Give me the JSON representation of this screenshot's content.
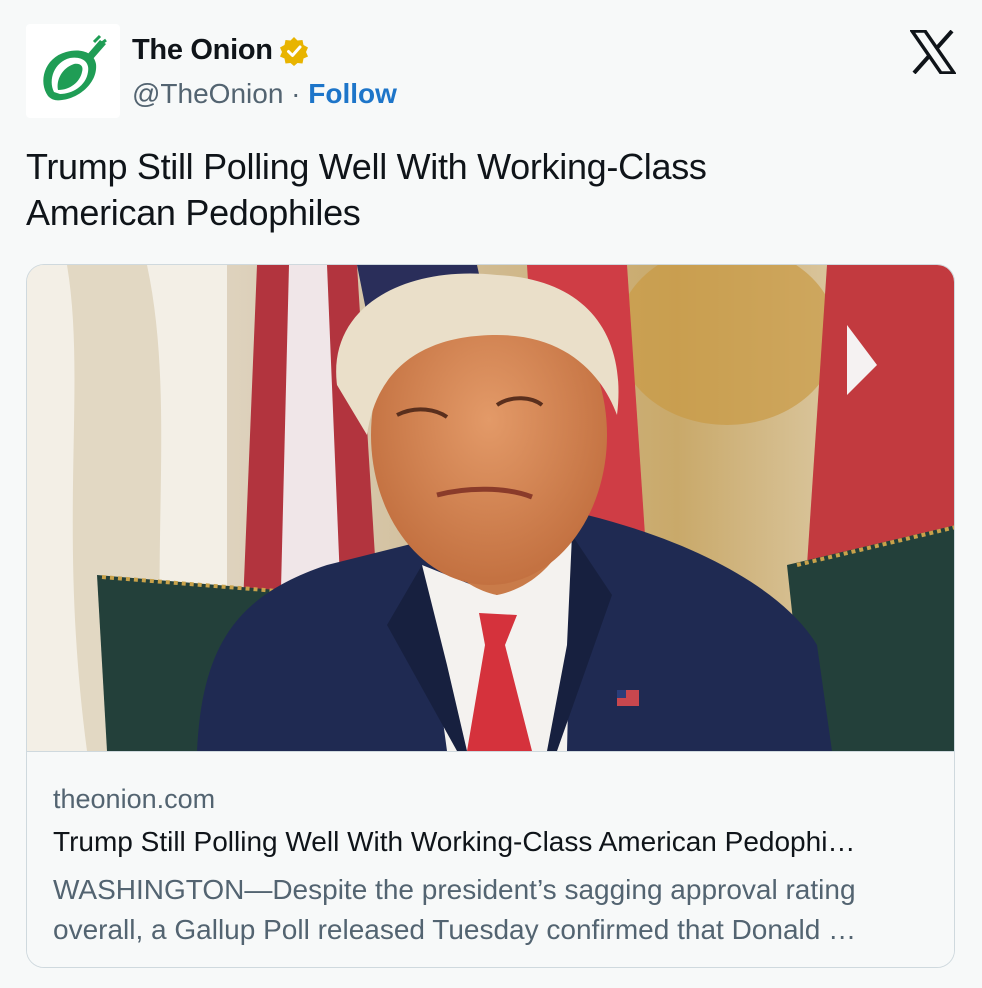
{
  "account": {
    "avatar_icon": "onion-logo-icon",
    "name": "The Onion",
    "handle": "@TheOnion",
    "separator": "·",
    "follow_label": "Follow",
    "verified_icon": "verified-badge-icon",
    "brand_icon": "x-logo-icon"
  },
  "tweet": {
    "text_line1": "Trump Still Polling Well With Working-Class",
    "text_line2": "American Pedophiles"
  },
  "link_card": {
    "image_icon": "article-photo",
    "domain": "theonion.com",
    "title": "Trump Still Polling Well With Working-Class American Pedophi…",
    "desc_line1": "WASHINGTON—Despite the president’s sagging approval rating",
    "desc_line2": "overall, a Gallup Poll released Tuesday confirmed that Donald …"
  },
  "colors": {
    "follow": "#1d75c9",
    "secondary_text": "#536471",
    "verified": "#e8b400",
    "onion_green": "#1f9d55"
  }
}
